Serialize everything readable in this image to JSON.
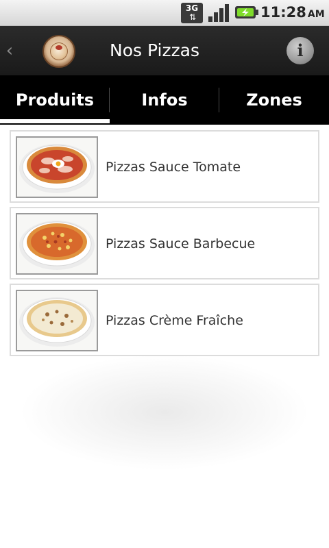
{
  "status_bar": {
    "network": "3G",
    "time": "11:28",
    "ampm": "AM"
  },
  "header": {
    "title": "Nos Pizzas",
    "info_icon": "i",
    "back_icon": "chevron-left-icon"
  },
  "tabs": [
    {
      "label": "Produits",
      "selected": true
    },
    {
      "label": "Infos",
      "selected": false
    },
    {
      "label": "Zones",
      "selected": false
    }
  ],
  "products": [
    {
      "label": "Pizzas Sauce Tomate"
    },
    {
      "label": "Pizzas Sauce Barbecue"
    },
    {
      "label": "Pizzas Crème Fraîche"
    }
  ],
  "colors": {
    "header_bg": "#1f1f1f",
    "tabs_bg": "#000000",
    "text": "#333333"
  }
}
